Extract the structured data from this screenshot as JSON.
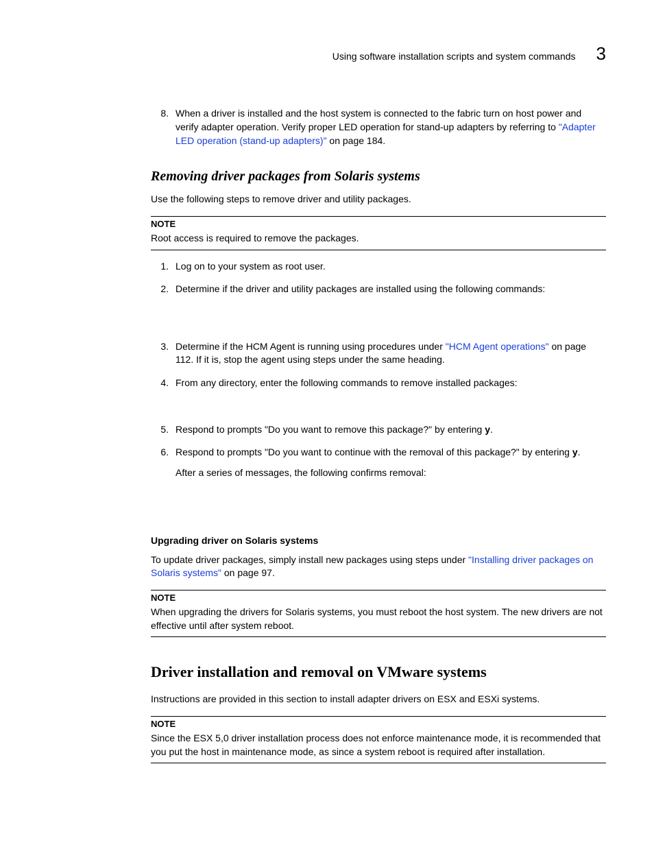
{
  "header": {
    "section": "Using software installation scripts and system commands",
    "chapter": "3"
  },
  "step8": {
    "num": "8.",
    "preText": "When a driver is installed and the host system is connected to the fabric turn on host power and verify adapter operation. Verify proper LED operation for stand-up adapters by referring to ",
    "link": "\"Adapter LED operation (stand-up adapters)\"",
    "postText": " on page 184."
  },
  "removing": {
    "heading": "Removing driver packages from Solaris systems",
    "intro": "Use the following steps to remove driver and utility packages.",
    "note1Label": "NOTE",
    "note1Text": "Root access is required to remove the packages.",
    "steps": {
      "s1": "Log on to your system as root user.",
      "s2": "Determine if the driver and utility packages are installed using the following commands:",
      "s3_pre": "Determine if the HCM Agent is running using procedures under ",
      "s3_link": "\"HCM Agent operations\"",
      "s3_post": " on page 112. If it is, stop the agent using steps under the same heading.",
      "s4": "From any directory, enter the following commands to remove installed packages:",
      "s5_pre": "Respond to prompts \"Do you want to remove this package?\" by entering ",
      "s5_bold": "y",
      "s5_post": ".",
      "s6_pre": "Respond to prompts \"Do you want to continue with the removal of this package?\" by entering ",
      "s6_bold": "y",
      "s6_post": ".",
      "s6_sub": "After a series of messages, the following confirms removal:"
    }
  },
  "upgrading": {
    "heading": "Upgrading driver on Solaris systems",
    "text_pre": "To update driver packages, simply install new packages using steps under ",
    "link": "\"Installing driver packages on Solaris systems\"",
    "text_post": " on page 97.",
    "noteLabel": "NOTE",
    "noteText": "When upgrading the drivers for Solaris systems, you must reboot the host system. The new drivers are not effective until after system reboot."
  },
  "vmware": {
    "heading": "Driver installation and removal on VMware systems",
    "intro": "Instructions are provided in this section to install adapter drivers on ESX and ESXi systems.",
    "noteLabel": "NOTE",
    "noteText": "Since the ESX 5,0 driver installation process does not enforce maintenance mode, it is recommended that you put the host in maintenance mode, as since a system reboot is required after installation."
  }
}
